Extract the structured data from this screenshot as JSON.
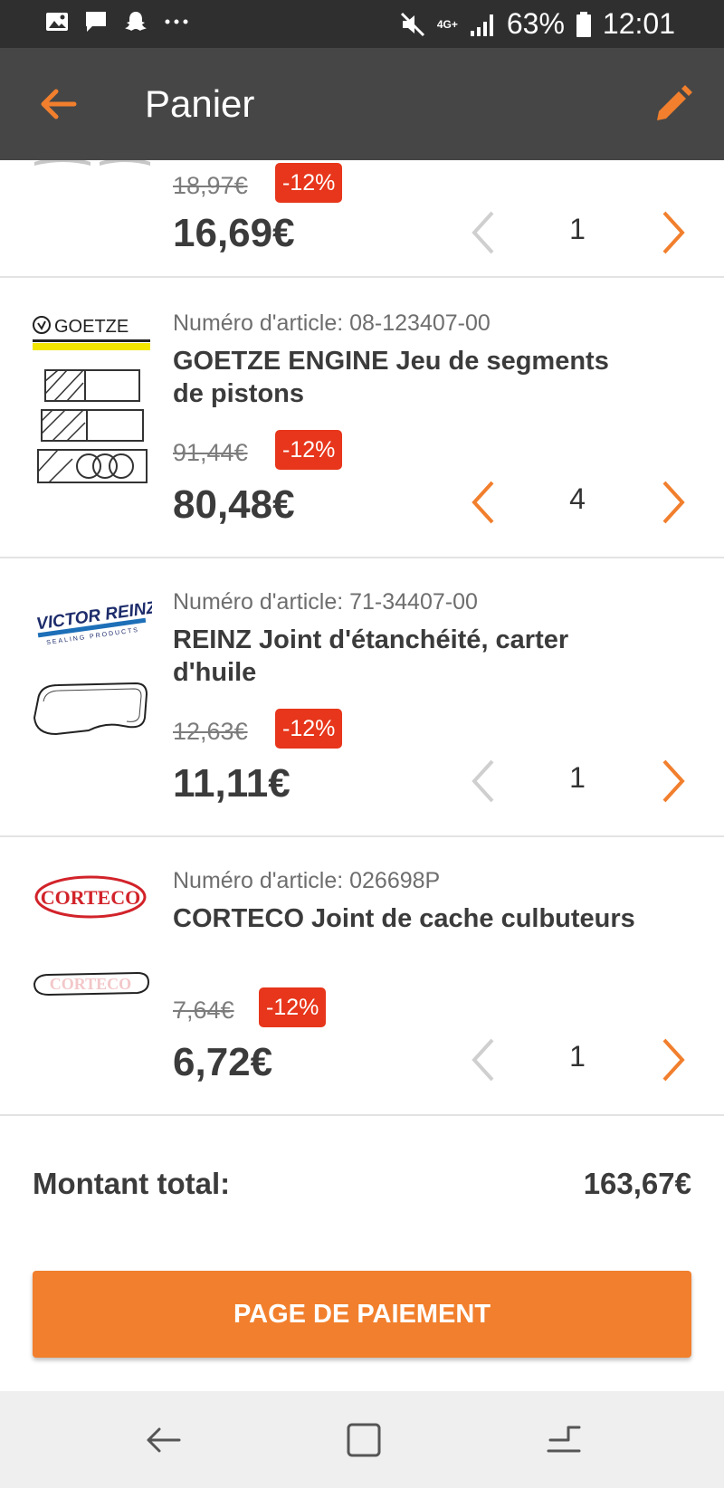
{
  "status_bar": {
    "icons_left": [
      "gallery-icon",
      "message-icon",
      "snapchat-icon",
      "more-dots-icon"
    ],
    "network": "4G+",
    "battery": "63%",
    "time": "12:01"
  },
  "app_bar": {
    "title": "Panier",
    "back_icon": "back-arrow-icon",
    "edit_icon": "pencil-icon",
    "accent": "#f17f2d"
  },
  "items": [
    {
      "brand": "",
      "article_label": "",
      "name": "",
      "old_price": "18,97€",
      "discount": "-12%",
      "price": "16,69€",
      "quantity": "1"
    },
    {
      "brand": "GOETZE",
      "article_label": "Numéro d'article: 08-123407-00",
      "name": "GOETZE ENGINE Jeu de segments de pistons",
      "old_price": "91,44€",
      "discount": "-12%",
      "price": "80,48€",
      "quantity": "4"
    },
    {
      "brand": "VICTOR REINZ",
      "brand_sub": "SEALING PRODUCTS",
      "article_label": "Numéro d'article: 71-34407-00",
      "name": "REINZ Joint d'étanchéité, carter d'huile",
      "old_price": "12,63€",
      "discount": "-12%",
      "price": "11,11€",
      "quantity": "1"
    },
    {
      "brand": "CORTECO",
      "article_label": "Numéro d'article: 026698P",
      "name": "CORTECO Joint de cache culbuteurs",
      "old_price": "7,64€",
      "discount": "-12%",
      "price": "6,72€",
      "quantity": "1"
    }
  ],
  "total": {
    "label": "Montant total:",
    "value": "163,67€"
  },
  "checkout": {
    "label": "PAGE DE PAIEMENT"
  },
  "nav_bar": {
    "icons": [
      "nav-back-icon",
      "nav-home-icon",
      "nav-recents-icon"
    ]
  }
}
